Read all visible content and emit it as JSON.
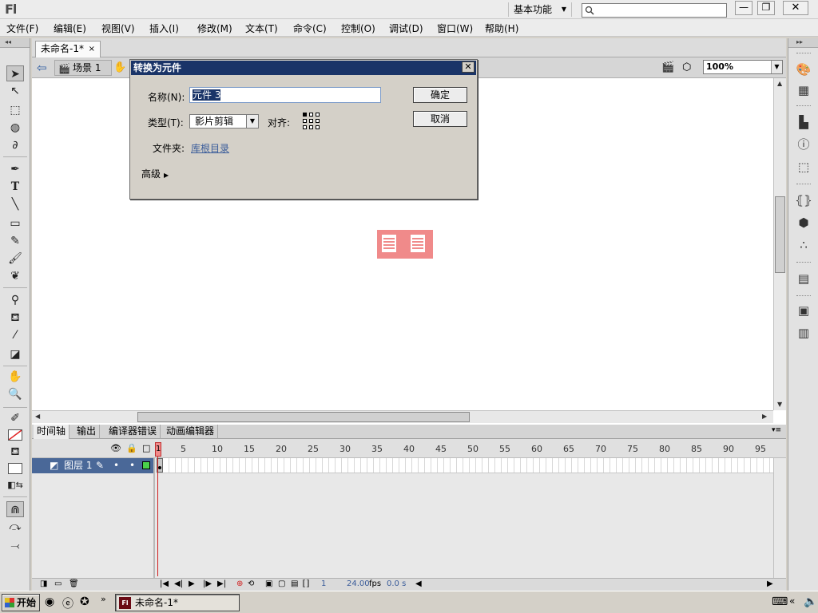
{
  "app": {
    "logo": "Fl",
    "workspace": "基本功能",
    "search_placeholder": "",
    "win_min": "—",
    "win_max": "❐",
    "win_close": "✕"
  },
  "menu": [
    "文件(F)",
    "编辑(E)",
    "视图(V)",
    "插入(I)",
    "修改(M)",
    "文本(T)",
    "命令(C)",
    "控制(O)",
    "调试(D)",
    "窗口(W)",
    "帮助(H)"
  ],
  "document": {
    "tab_title": "未命名-1*",
    "tab_close": "×",
    "scene": "场景 1",
    "zoom": "100%"
  },
  "dialog": {
    "title": "转换为元件",
    "close": "✕",
    "name_label": "名称(N):",
    "name_value": "元件 3",
    "type_label": "类型(T):",
    "type_value": "影片剪辑",
    "align_label": "对齐:",
    "folder_label": "文件夹:",
    "folder_value": "库根目录",
    "advanced": "高级",
    "ok": "确定",
    "cancel": "取消"
  },
  "timeline": {
    "tabs": [
      "时间轴",
      "输出",
      "编译器错误",
      "动画编辑器"
    ],
    "ruler": [
      "1",
      "5",
      "10",
      "15",
      "20",
      "25",
      "30",
      "35",
      "40",
      "45",
      "50",
      "55",
      "60",
      "65",
      "70",
      "75",
      "80",
      "85",
      "90",
      "95"
    ],
    "layer_name": "图层 1",
    "frame": "1",
    "fps": "24.00",
    "fps_unit": "fps",
    "time": "0.0 s"
  },
  "taskbar": {
    "start": "开始",
    "task_title": "未命名-1*",
    "task_icon": "Fl",
    "chevron": "»"
  },
  "icons": {
    "search": "search-icon",
    "selection": "arrow-icon",
    "text": "T"
  }
}
